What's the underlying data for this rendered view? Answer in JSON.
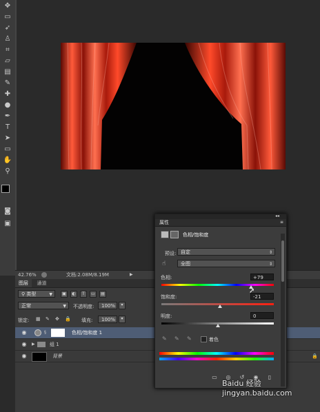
{
  "status": {
    "zoom": "42.76%",
    "doc": "文档:2.08M/8.19M"
  },
  "layers_panel": {
    "tabs": [
      "图层",
      "通道"
    ],
    "kind_filter": "类型",
    "blend_mode": "正常",
    "opacity_label": "不透明度:",
    "opacity_value": "100%",
    "lock_label": "锁定:",
    "fill_label": "填充:",
    "fill_value": "100%",
    "layers": [
      {
        "name": "色相/饱和度 1",
        "selected": true
      },
      {
        "name": "组 1",
        "selected": false
      },
      {
        "name": "背景",
        "selected": false
      }
    ]
  },
  "properties_panel": {
    "title": "属性",
    "adjustment_title": "色相/饱和度",
    "preset_label": "预设:",
    "preset_value": "自定",
    "channel_value": "全图",
    "hue_label": "色相:",
    "hue_value": "+79",
    "hue_slider_fraction": 0.8,
    "saturation_label": "饱和度:",
    "saturation_value": "-21",
    "saturation_slider_fraction": 0.52,
    "lightness_label": "明度:",
    "lightness_value": "0",
    "lightness_slider_fraction": 0.5,
    "colorize_label": "着色"
  },
  "colors": {
    "panel_bg": "#3c3c3c",
    "selection": "#4e5d75"
  },
  "watermark": "Baidu 经验 jingyan.baidu.com"
}
